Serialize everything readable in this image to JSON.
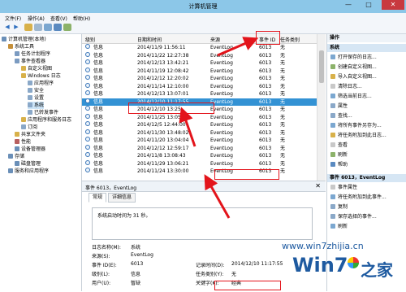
{
  "window": {
    "title": "计算机管理",
    "min": "—",
    "max": "□",
    "close": "✕"
  },
  "menu": [
    "文件(F)",
    "操作(A)",
    "查看(V)",
    "帮助(H)"
  ],
  "tree": [
    {
      "label": "计算机管理(本地)",
      "indent": 0,
      "color": "#6a8fb8"
    },
    {
      "label": "系统工具",
      "indent": 1,
      "color": "#c58f3a"
    },
    {
      "label": "任务计划程序",
      "indent": 2,
      "color": "#7b9bc1"
    },
    {
      "label": "事件查看器",
      "indent": 2,
      "color": "#7b9bc1"
    },
    {
      "label": "自定义视图",
      "indent": 3,
      "color": "#d8b14a"
    },
    {
      "label": "Windows 日志",
      "indent": 3,
      "color": "#d8b14a"
    },
    {
      "label": "应用程序",
      "indent": 4,
      "color": "#8aa8c8"
    },
    {
      "label": "安全",
      "indent": 4,
      "color": "#8aa8c8"
    },
    {
      "label": "设置",
      "indent": 4,
      "color": "#8aa8c8"
    },
    {
      "label": "系统",
      "indent": 4,
      "color": "#8aa8c8",
      "selected": true
    },
    {
      "label": "已转发事件",
      "indent": 4,
      "color": "#8aa8c8"
    },
    {
      "label": "应用程序和服务日志",
      "indent": 3,
      "color": "#d8b14a"
    },
    {
      "label": "订阅",
      "indent": 3,
      "color": "#8aa8c8"
    },
    {
      "label": "共享文件夹",
      "indent": 2,
      "color": "#d8b14a"
    },
    {
      "label": "性能",
      "indent": 2,
      "color": "#b86060"
    },
    {
      "label": "设备管理器",
      "indent": 2,
      "color": "#6a8fb8"
    },
    {
      "label": "存储",
      "indent": 1,
      "color": "#6a8fb8"
    },
    {
      "label": "磁盘管理",
      "indent": 2,
      "color": "#6a8fb8"
    },
    {
      "label": "服务和应用程序",
      "indent": 1,
      "color": "#6a8fb8"
    }
  ],
  "list": {
    "headers": {
      "level": "级别",
      "datetime": "日期和时间",
      "source": "来源",
      "eventid": "事件 ID",
      "category": "任务类别"
    },
    "rows": [
      {
        "level": "信息",
        "datetime": "2014/11/9 11:56:11",
        "source": "EventLog",
        "eventid": "6013",
        "category": "无"
      },
      {
        "level": "信息",
        "datetime": "2014/11/22 12:27:38",
        "source": "EventLog",
        "eventid": "6013",
        "category": "无"
      },
      {
        "level": "信息",
        "datetime": "2014/12/13 13:42:21",
        "source": "EventLog",
        "eventid": "6013",
        "category": "无"
      },
      {
        "level": "信息",
        "datetime": "2014/11/19 12:08:42",
        "source": "EventLog",
        "eventid": "6013",
        "category": "无"
      },
      {
        "level": "信息",
        "datetime": "2014/12/12 12:20:02",
        "source": "EventLog",
        "eventid": "6013",
        "category": "无"
      },
      {
        "level": "信息",
        "datetime": "2014/11/14 12:10:00",
        "source": "EventLog",
        "eventid": "6013",
        "category": "无"
      },
      {
        "level": "信息",
        "datetime": "2014/12/13 13:07:01",
        "source": "EventLog",
        "eventid": "6013",
        "category": "无"
      },
      {
        "level": "信息",
        "datetime": "2014/12/10 11:17:55",
        "source": "EventLog",
        "eventid": "6013",
        "category": "无",
        "selected": true
      },
      {
        "level": "信息",
        "datetime": "2014/12/10 13:25",
        "source": "EventLog",
        "eventid": "6013",
        "category": "无"
      },
      {
        "level": "信息",
        "datetime": "2014/11/25 13:05:1",
        "source": "EventLog",
        "eventid": "6013",
        "category": "无"
      },
      {
        "level": "信息",
        "datetime": "2014/12/5 12:44:00",
        "source": "EventLog",
        "eventid": "6013",
        "category": "无"
      },
      {
        "level": "信息",
        "datetime": "2014/11/30 13:48:02",
        "source": "EventLog",
        "eventid": "6013",
        "category": "无"
      },
      {
        "level": "信息",
        "datetime": "2014/11/20 13:04:04",
        "source": "EventLog",
        "eventid": "6013",
        "category": "无"
      },
      {
        "level": "信息",
        "datetime": "2014/12/12 12:59:17",
        "source": "EventLog",
        "eventid": "6013",
        "category": "无"
      },
      {
        "level": "信息",
        "datetime": "2014/11/8 13:08:43",
        "source": "EventLog",
        "eventid": "6013",
        "category": "无"
      },
      {
        "level": "信息",
        "datetime": "2014/11/29 13:06:21",
        "source": "EventLog",
        "eventid": "6013",
        "category": "无"
      },
      {
        "level": "信息",
        "datetime": "2014/11/24 13:30:00",
        "source": "EventLog",
        "eventid": "6013",
        "category": "无"
      }
    ]
  },
  "detail": {
    "header": "事件 6013，EventLog",
    "tabs": [
      "常规",
      "详细信息"
    ],
    "message": "系统启动时间为 31 秒。",
    "fields": [
      {
        "label": "日志名称(M):",
        "value": "系统"
      },
      {
        "label": "来源(S):",
        "value": "EventLog"
      },
      {
        "label": "事件 ID(E):",
        "value": "6013"
      },
      {
        "label": "级别(L):",
        "value": "信息"
      },
      {
        "label": "用户(U):",
        "value": "暂缺"
      }
    ],
    "fields2": [
      {
        "label": "记录时间(D):",
        "value": "2014/12/10 11:17:55"
      },
      {
        "label": "任务类别(Y):",
        "value": "无"
      },
      {
        "label": "关键字(K):",
        "value": "经典"
      }
    ]
  },
  "actions": {
    "title": "操作",
    "section1": "系统",
    "items1": [
      "打开保存的日志...",
      "创建自定义视图...",
      "导入自定义视图...",
      "清除日志...",
      "筛选当前日志...",
      "属性",
      "查找...",
      "将所有事件另存为...",
      "将任务附加到此日志...",
      "查看",
      "刷新",
      "帮助"
    ],
    "section2": "事件 6013，EventLog",
    "items2": [
      "事件属性",
      "将任务附加到此事件...",
      "复制",
      "保存选择的事件...",
      "刷新"
    ]
  },
  "watermark": {
    "url": "www.win7zhijia.cn",
    "brand": "Win7",
    "suffix": "之家"
  }
}
